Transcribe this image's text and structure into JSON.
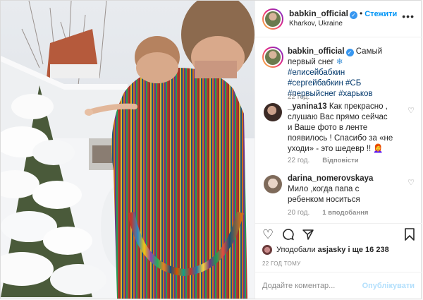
{
  "header": {
    "username": "babkin_official",
    "verified_mark": "✓",
    "separator": "•",
    "follow_label": "Стежити",
    "location": "Kharkov, Ukraine",
    "more_icon": "more-dots-icon"
  },
  "caption": {
    "username": "babkin_official",
    "text": "Самый первый снег",
    "emoji": "❄",
    "hashtags": "#елисейбабкин #сергейбабкин #СБ #первыйснег #харьков",
    "time": "22 год."
  },
  "comments": [
    {
      "username": "_yanina13",
      "text": "Как прекрасно , слушаю Вас прямо сейчас и Ваше фото в ленте появилось ! Спасибо за «не уходи» - это шедевр !!",
      "emoji": "👩‍🦰",
      "time": "22 год.",
      "reply_label": "Відповісти"
    },
    {
      "username": "darina_nomerovskaya",
      "text": "Мило ,когда папа с ребенком носиться",
      "time": "20 год.",
      "likes_label": "1 вподобання"
    }
  ],
  "actions": {
    "like_icon": "heart-icon",
    "comment_icon": "comment-icon",
    "share_icon": "share-icon",
    "save_icon": "bookmark-icon"
  },
  "likes": {
    "prefix": "Уподобали",
    "user": "asjasky",
    "suffix": "і ще 16 238"
  },
  "post_time": "22 ГОД ТОМУ",
  "add_comment": {
    "placeholder": "Додайте коментар...",
    "publish_label": "Опублікувати"
  },
  "colors": {
    "accent": "#0095f6",
    "publish_disabled": "#b2dffc",
    "muted": "#8e8e8e",
    "hashtag": "#00376b"
  }
}
